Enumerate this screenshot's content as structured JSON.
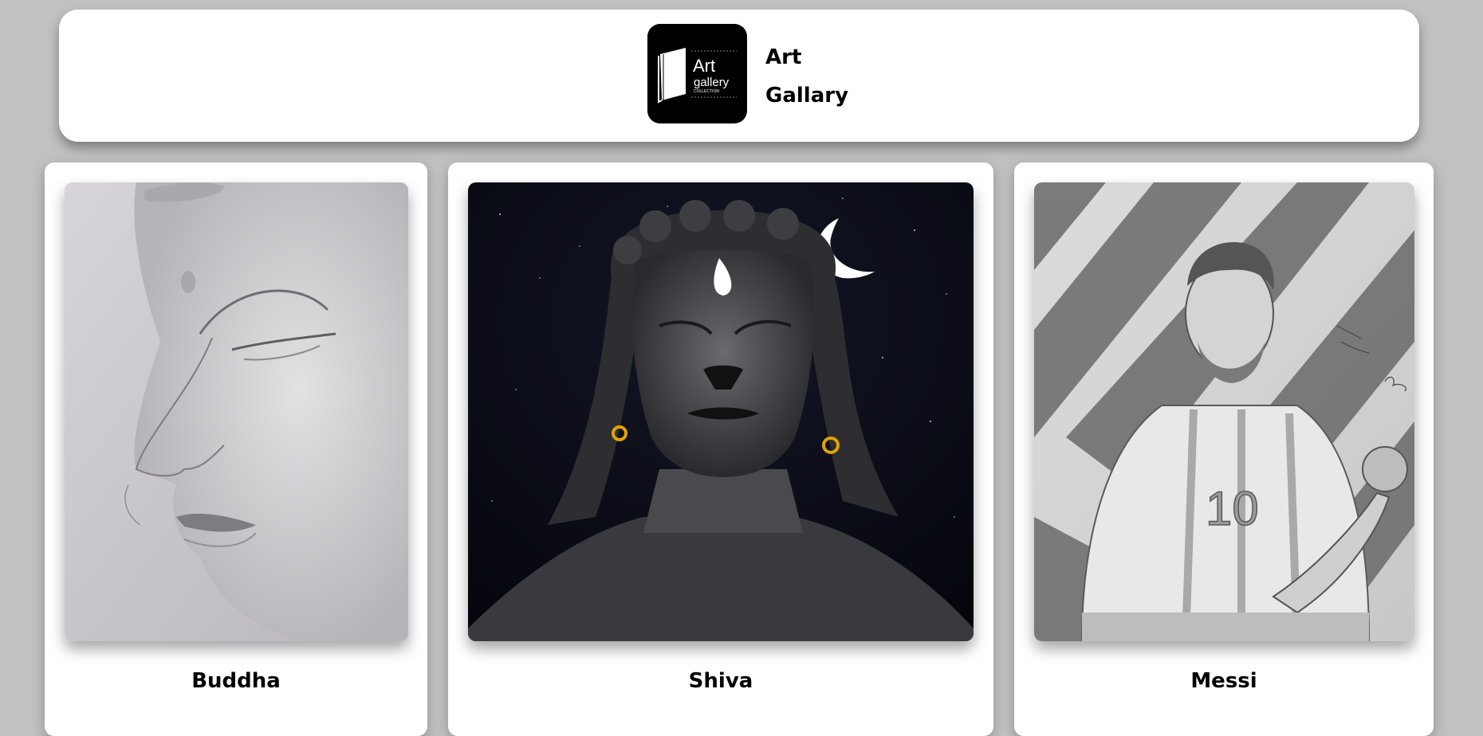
{
  "header": {
    "logo": {
      "icon": "book-icon",
      "line1": "Art",
      "line2": "gallery",
      "line3": "COLLECTION"
    },
    "title_line1": "Art",
    "title_line2": "Gallary"
  },
  "cards": [
    {
      "title": "Buddha",
      "image": "buddha-pencil-sketch"
    },
    {
      "title": "Shiva",
      "image": "shiva-charcoal-night"
    },
    {
      "title": "Messi",
      "image": "messi-pencil-sketch"
    }
  ],
  "colors": {
    "background": "#c1c1c1",
    "card": "#ffffff",
    "logo_bg": "#000000",
    "earring": "#e0a400",
    "night_sky": "#0b0c18"
  }
}
